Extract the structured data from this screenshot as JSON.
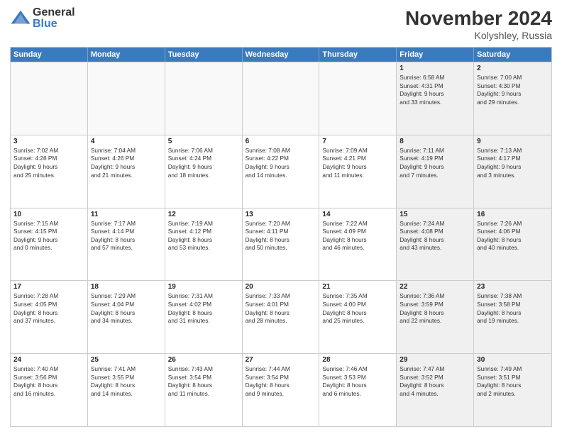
{
  "logo": {
    "general": "General",
    "blue": "Blue"
  },
  "title": {
    "month": "November 2024",
    "location": "Kolyshley, Russia"
  },
  "header": {
    "days": [
      "Sunday",
      "Monday",
      "Tuesday",
      "Wednesday",
      "Thursday",
      "Friday",
      "Saturday"
    ]
  },
  "weeks": [
    [
      {
        "day": "",
        "empty": true,
        "lines": []
      },
      {
        "day": "",
        "empty": true,
        "lines": []
      },
      {
        "day": "",
        "empty": true,
        "lines": []
      },
      {
        "day": "",
        "empty": true,
        "lines": []
      },
      {
        "day": "",
        "empty": true,
        "lines": []
      },
      {
        "day": "1",
        "shaded": true,
        "lines": [
          "Sunrise: 6:58 AM",
          "Sunset: 4:31 PM",
          "Daylight: 9 hours",
          "and 33 minutes."
        ]
      },
      {
        "day": "2",
        "shaded": true,
        "lines": [
          "Sunrise: 7:00 AM",
          "Sunset: 4:30 PM",
          "Daylight: 9 hours",
          "and 29 minutes."
        ]
      }
    ],
    [
      {
        "day": "3",
        "lines": [
          "Sunrise: 7:02 AM",
          "Sunset: 4:28 PM",
          "Daylight: 9 hours",
          "and 25 minutes."
        ]
      },
      {
        "day": "4",
        "lines": [
          "Sunrise: 7:04 AM",
          "Sunset: 4:26 PM",
          "Daylight: 9 hours",
          "and 21 minutes."
        ]
      },
      {
        "day": "5",
        "lines": [
          "Sunrise: 7:06 AM",
          "Sunset: 4:24 PM",
          "Daylight: 9 hours",
          "and 18 minutes."
        ]
      },
      {
        "day": "6",
        "lines": [
          "Sunrise: 7:08 AM",
          "Sunset: 4:22 PM",
          "Daylight: 9 hours",
          "and 14 minutes."
        ]
      },
      {
        "day": "7",
        "lines": [
          "Sunrise: 7:09 AM",
          "Sunset: 4:21 PM",
          "Daylight: 9 hours",
          "and 11 minutes."
        ]
      },
      {
        "day": "8",
        "shaded": true,
        "lines": [
          "Sunrise: 7:11 AM",
          "Sunset: 4:19 PM",
          "Daylight: 9 hours",
          "and 7 minutes."
        ]
      },
      {
        "day": "9",
        "shaded": true,
        "lines": [
          "Sunrise: 7:13 AM",
          "Sunset: 4:17 PM",
          "Daylight: 9 hours",
          "and 3 minutes."
        ]
      }
    ],
    [
      {
        "day": "10",
        "lines": [
          "Sunrise: 7:15 AM",
          "Sunset: 4:15 PM",
          "Daylight: 9 hours",
          "and 0 minutes."
        ]
      },
      {
        "day": "11",
        "lines": [
          "Sunrise: 7:17 AM",
          "Sunset: 4:14 PM",
          "Daylight: 8 hours",
          "and 57 minutes."
        ]
      },
      {
        "day": "12",
        "lines": [
          "Sunrise: 7:19 AM",
          "Sunset: 4:12 PM",
          "Daylight: 8 hours",
          "and 53 minutes."
        ]
      },
      {
        "day": "13",
        "lines": [
          "Sunrise: 7:20 AM",
          "Sunset: 4:11 PM",
          "Daylight: 8 hours",
          "and 50 minutes."
        ]
      },
      {
        "day": "14",
        "lines": [
          "Sunrise: 7:22 AM",
          "Sunset: 4:09 PM",
          "Daylight: 8 hours",
          "and 46 minutes."
        ]
      },
      {
        "day": "15",
        "shaded": true,
        "lines": [
          "Sunrise: 7:24 AM",
          "Sunset: 4:08 PM",
          "Daylight: 8 hours",
          "and 43 minutes."
        ]
      },
      {
        "day": "16",
        "shaded": true,
        "lines": [
          "Sunrise: 7:26 AM",
          "Sunset: 4:06 PM",
          "Daylight: 8 hours",
          "and 40 minutes."
        ]
      }
    ],
    [
      {
        "day": "17",
        "lines": [
          "Sunrise: 7:28 AM",
          "Sunset: 4:05 PM",
          "Daylight: 8 hours",
          "and 37 minutes."
        ]
      },
      {
        "day": "18",
        "lines": [
          "Sunrise: 7:29 AM",
          "Sunset: 4:04 PM",
          "Daylight: 8 hours",
          "and 34 minutes."
        ]
      },
      {
        "day": "19",
        "lines": [
          "Sunrise: 7:31 AM",
          "Sunset: 4:02 PM",
          "Daylight: 8 hours",
          "and 31 minutes."
        ]
      },
      {
        "day": "20",
        "lines": [
          "Sunrise: 7:33 AM",
          "Sunset: 4:01 PM",
          "Daylight: 8 hours",
          "and 28 minutes."
        ]
      },
      {
        "day": "21",
        "lines": [
          "Sunrise: 7:35 AM",
          "Sunset: 4:00 PM",
          "Daylight: 8 hours",
          "and 25 minutes."
        ]
      },
      {
        "day": "22",
        "shaded": true,
        "lines": [
          "Sunrise: 7:36 AM",
          "Sunset: 3:59 PM",
          "Daylight: 8 hours",
          "and 22 minutes."
        ]
      },
      {
        "day": "23",
        "shaded": true,
        "lines": [
          "Sunrise: 7:38 AM",
          "Sunset: 3:58 PM",
          "Daylight: 8 hours",
          "and 19 minutes."
        ]
      }
    ],
    [
      {
        "day": "24",
        "lines": [
          "Sunrise: 7:40 AM",
          "Sunset: 3:56 PM",
          "Daylight: 8 hours",
          "and 16 minutes."
        ]
      },
      {
        "day": "25",
        "lines": [
          "Sunrise: 7:41 AM",
          "Sunset: 3:55 PM",
          "Daylight: 8 hours",
          "and 14 minutes."
        ]
      },
      {
        "day": "26",
        "lines": [
          "Sunrise: 7:43 AM",
          "Sunset: 3:54 PM",
          "Daylight: 8 hours",
          "and 11 minutes."
        ]
      },
      {
        "day": "27",
        "lines": [
          "Sunrise: 7:44 AM",
          "Sunset: 3:54 PM",
          "Daylight: 8 hours",
          "and 9 minutes."
        ]
      },
      {
        "day": "28",
        "lines": [
          "Sunrise: 7:46 AM",
          "Sunset: 3:53 PM",
          "Daylight: 8 hours",
          "and 6 minutes."
        ]
      },
      {
        "day": "29",
        "shaded": true,
        "lines": [
          "Sunrise: 7:47 AM",
          "Sunset: 3:52 PM",
          "Daylight: 8 hours",
          "and 4 minutes."
        ]
      },
      {
        "day": "30",
        "shaded": true,
        "lines": [
          "Sunrise: 7:49 AM",
          "Sunset: 3:51 PM",
          "Daylight: 8 hours",
          "and 2 minutes."
        ]
      }
    ]
  ]
}
